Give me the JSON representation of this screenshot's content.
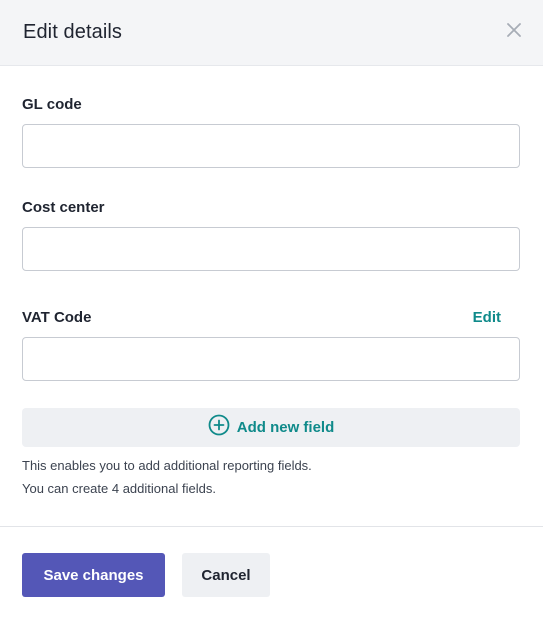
{
  "modal": {
    "title": "Edit details",
    "close_icon": "close-icon"
  },
  "fields": [
    {
      "label": "GL code",
      "value": ""
    },
    {
      "label": "Cost center",
      "value": ""
    },
    {
      "label": "VAT Code",
      "value": "",
      "action_label": "Edit"
    }
  ],
  "add_field": {
    "label": "Add new field",
    "icon": "plus-circle-icon",
    "help_line_1": "This enables you to add additional reporting fields.",
    "help_line_2": "You can create 4 additional fields."
  },
  "footer": {
    "save_label": "Save changes",
    "cancel_label": "Cancel"
  },
  "colors": {
    "primary": "#5457b7",
    "accent": "#0f8a8a",
    "header_bg": "#f4f5f7"
  }
}
